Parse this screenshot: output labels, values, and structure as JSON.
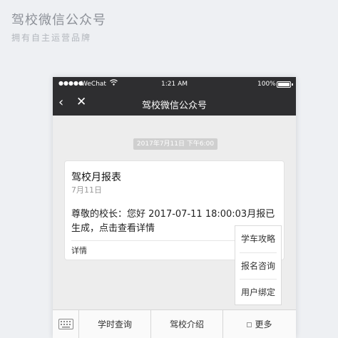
{
  "page": {
    "title": "驾校微信公众号",
    "subtitle": "拥有自主运营品牌"
  },
  "status_bar": {
    "signal": "●●●●●",
    "carrier": "WeChat",
    "time": "1:21 AM",
    "battery": "100%"
  },
  "nav_bar": {
    "back": "‹",
    "close": "✕",
    "title": "驾校微信公众号"
  },
  "chat": {
    "timestamp": "2017年7月11日 下午6:00",
    "card": {
      "title": "驾校月报表",
      "date": "7月11日",
      "body": "尊敬的校长：您好 2017-07-11 18:00:03月报已生成，点击查看详情",
      "detail_label": "详情"
    }
  },
  "popup_menu": {
    "items": [
      "学车攻略",
      "报名咨询",
      "用户绑定"
    ]
  },
  "bottom_menu": {
    "items": [
      "学时查询",
      "驾校介绍",
      "更多"
    ]
  },
  "colors": {
    "page_background": "#eef0f3",
    "header_background": "#2e2e30",
    "chat_background": "#ededed"
  }
}
